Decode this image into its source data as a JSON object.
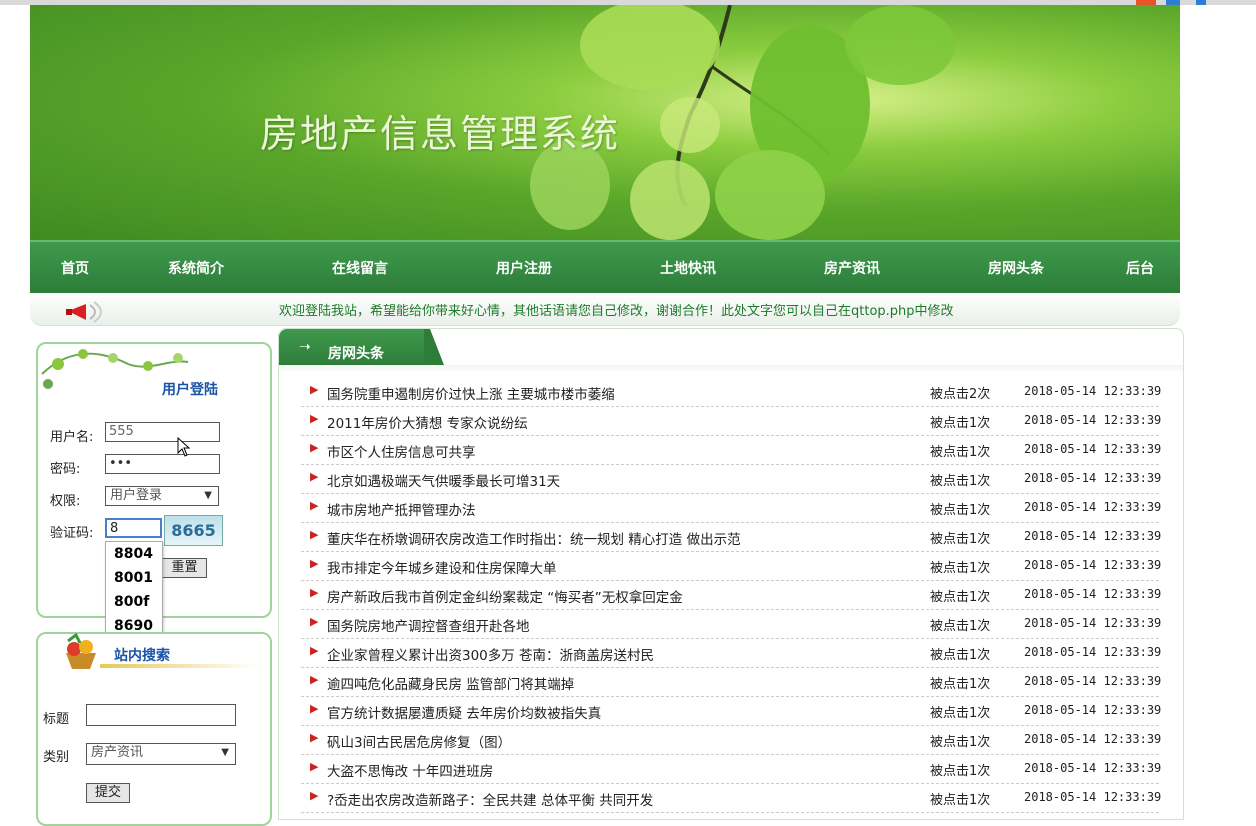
{
  "header": {
    "site_title": "房地产信息管理系统"
  },
  "nav": [
    {
      "label": "首页"
    },
    {
      "label": "系统简介"
    },
    {
      "label": "在线留言"
    },
    {
      "label": "用户注册"
    },
    {
      "label": "土地快讯"
    },
    {
      "label": "房产资讯"
    },
    {
      "label": "房网头条"
    },
    {
      "label": "后台"
    }
  ],
  "notice": {
    "text": "欢迎登陆我站，希望能给你带来好心情，其他话语请您自己修改，谢谢合作！此处文字您可以自己在qttop.php中修改"
  },
  "login": {
    "title": "用户登陆",
    "username_label": "用户名:",
    "username_value": "555",
    "password_label": "密码:",
    "password_value": "•••",
    "role_label": "权限:",
    "role_value": "用户登录",
    "captcha_label": "验证码:",
    "captcha_input": "8",
    "captcha_image": "8665",
    "reset_label": "重置",
    "suggestions": [
      "8804",
      "8001",
      "800f",
      "8690"
    ]
  },
  "search": {
    "title": "站内搜索",
    "title_label": "标题",
    "category_label": "类别",
    "category_value": "房产资讯",
    "submit_label": "提交"
  },
  "news": {
    "tab_label": "房网头条",
    "items": [
      {
        "title": "国务院重申遏制房价过快上涨 主要城市楼市萎缩",
        "clicks": "被点击2次",
        "date": "2018-05-14 12:33:39"
      },
      {
        "title": "2011年房价大猜想 专家众说纷纭",
        "clicks": "被点击1次",
        "date": "2018-05-14 12:33:39"
      },
      {
        "title": "市区个人住房信息可共享",
        "clicks": "被点击1次",
        "date": "2018-05-14 12:33:39"
      },
      {
        "title": "北京如遇极端天气供暖季最长可增31天",
        "clicks": "被点击1次",
        "date": "2018-05-14 12:33:39"
      },
      {
        "title": "城市房地产抵押管理办法",
        "clicks": "被点击1次",
        "date": "2018-05-14 12:33:39"
      },
      {
        "title": "董庆华在桥墩调研农房改造工作时指出：统一规划 精心打造 做出示范",
        "clicks": "被点击1次",
        "date": "2018-05-14 12:33:39"
      },
      {
        "title": "我市排定今年城乡建设和住房保障大单",
        "clicks": "被点击1次",
        "date": "2018-05-14 12:33:39"
      },
      {
        "title": "房产新政后我市首例定金纠纷案裁定 “悔买者”无权拿回定金",
        "clicks": "被点击1次",
        "date": "2018-05-14 12:33:39"
      },
      {
        "title": "国务院房地产调控督查组开赴各地",
        "clicks": "被点击1次",
        "date": "2018-05-14 12:33:39"
      },
      {
        "title": "企业家曾程义累计出资300多万 苍南：浙商盖房送村民",
        "clicks": "被点击1次",
        "date": "2018-05-14 12:33:39"
      },
      {
        "title": "逾四吨危化品藏身民房 监管部门将其端掉",
        "clicks": "被点击1次",
        "date": "2018-05-14 12:33:39"
      },
      {
        "title": "官方统计数据屡遭质疑 去年房价均数被指失真",
        "clicks": "被点击1次",
        "date": "2018-05-14 12:33:39"
      },
      {
        "title": "矾山3间古民居危房修复（图）",
        "clicks": "被点击1次",
        "date": "2018-05-14 12:33:39"
      },
      {
        "title": "大盗不思悔改 十年四进班房",
        "clicks": "被点击1次",
        "date": "2018-05-14 12:33:39"
      },
      {
        "title": "?岙走出农房改造新路子：全民共建 总体平衡 共同开发",
        "clicks": "被点击1次",
        "date": "2018-05-14 12:33:39"
      }
    ]
  },
  "colors": {
    "nav_green": "#2c7c39",
    "title_blue": "#1a54a6",
    "notice_green": "#1f7a2c",
    "bullet_red": "#cc2222"
  }
}
